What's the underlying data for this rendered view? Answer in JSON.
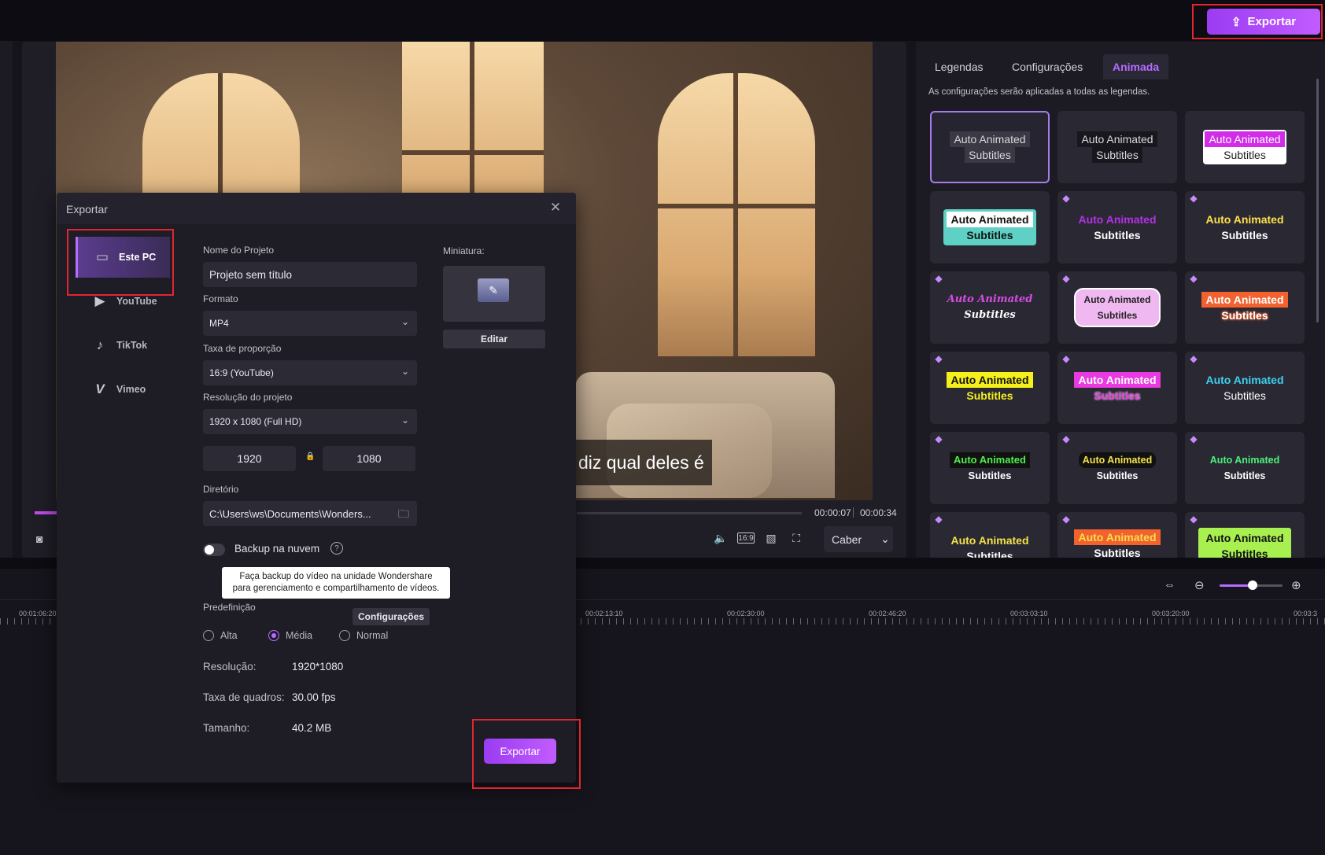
{
  "topbar": {
    "export_label": "Exportar"
  },
  "preview": {
    "subtitle_text": "diz qual deles é",
    "current_time": "00:00:07",
    "total_time": "00:00:34",
    "fit_label": "Caber"
  },
  "right_panel": {
    "tabs": [
      "Legendas",
      "Configurações",
      "Animada"
    ],
    "active_tab": "Animada",
    "note": "As configurações serão aplicadas a todas as legendas.",
    "styles": [
      {
        "line1": "Auto Animated",
        "line2": "Subtitles"
      },
      {
        "line1": "Auto Animated",
        "line2": "Subtitles"
      },
      {
        "line1": "Auto Animated",
        "line2": "Subtitles"
      },
      {
        "line1": "Auto Animated",
        "line2": "Subtitles"
      },
      {
        "line1": "Auto Animated",
        "line2": "Subtitles"
      },
      {
        "line1": "Auto Animated",
        "line2": "Subtitles"
      },
      {
        "line1": "Auto Animated",
        "line2": "Subtitles"
      },
      {
        "line1": "Auto Animated",
        "line2": "Subtitles"
      },
      {
        "line1": "Auto Animated",
        "line2": "Subtitles"
      },
      {
        "line1": "Auto Animated",
        "line2": "Subtitles"
      },
      {
        "line1": "Auto Animated",
        "line2": "Subtitles"
      },
      {
        "line1": "Auto Animated",
        "line2": "Subtitles"
      },
      {
        "line1": "Auto Animated",
        "line2": "Subtitles"
      },
      {
        "line1": "Auto Animated",
        "line2": "Subtitles"
      },
      {
        "line1": "Auto Animated",
        "line2": "Subtitles"
      },
      {
        "line1": "Auto Animated",
        "line2": "Subtitles"
      },
      {
        "line1": "Auto Animated",
        "line2": "Subtitles"
      },
      {
        "line1": "Auto Animated",
        "line2": "Subtitles"
      }
    ]
  },
  "timeline": {
    "ruler": [
      "00:01:06:20",
      "00:02:13:10",
      "00:02:30:00",
      "00:02:46:20",
      "00:03:03:10",
      "00:03:20:00",
      "00:03:3"
    ]
  },
  "dialog": {
    "title": "Exportar",
    "nav": [
      {
        "label": "Este PC",
        "icon": "monitor-icon"
      },
      {
        "label": "YouTube",
        "icon": "youtube-icon"
      },
      {
        "label": "TikTok",
        "icon": "tiktok-icon"
      },
      {
        "label": "Vimeo",
        "icon": "vimeo-icon"
      }
    ],
    "project_name_label": "Nome do Projeto",
    "project_name_value": "Projeto sem título",
    "format_label": "Formato",
    "format_value": "MP4",
    "aspect_label": "Taxa de proporção",
    "aspect_value": "16:9 (YouTube)",
    "resolution_label": "Resolução do projeto",
    "resolution_value": "1920 x 1080 (Full HD)",
    "width_value": "1920",
    "height_value": "1080",
    "directory_label": "Diretório",
    "directory_value": "C:\\Users\\ws\\Documents\\Wonders...",
    "thumbnail_label": "Miniatura:",
    "edit_label": "Editar",
    "backup_label": "Backup na nuvem",
    "backup_tooltip_line1": "Faça backup do vídeo na unidade Wondershare",
    "backup_tooltip_line2": "para gerenciamento e compartilhamento de vídeos.",
    "preset_label": "Predefinição",
    "settings_label": "Configurações",
    "presets": [
      "Alta",
      "Média",
      "Normal"
    ],
    "selected_preset": "Média",
    "info": {
      "resolution_label": "Resolução:",
      "resolution_value": "1920*1080",
      "framerate_label": "Taxa de quadros:",
      "framerate_value": "30.00 fps",
      "size_label": "Tamanho:",
      "size_value": "40.2 MB"
    },
    "export_label": "Exportar"
  }
}
